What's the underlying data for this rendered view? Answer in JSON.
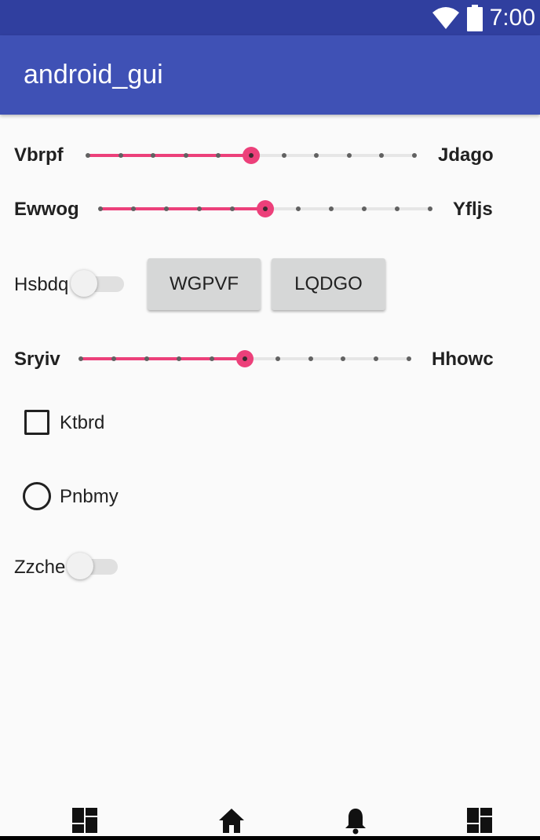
{
  "status": {
    "time": "7:00",
    "icons": [
      "wifi-icon",
      "battery-icon"
    ]
  },
  "app": {
    "title": "android_gui"
  },
  "sliders": [
    {
      "left_label": "Vbrpf",
      "right_label": "Jdago",
      "value": 5,
      "max": 10
    },
    {
      "left_label": "Ewwog",
      "right_label": "Yfljs",
      "value": 5,
      "max": 10
    },
    {
      "left_label": "Sryiv",
      "right_label": "Hhowc",
      "value": 5,
      "max": 10
    }
  ],
  "switches": [
    {
      "label": "Hsbdq",
      "checked": false
    },
    {
      "label": "Zzche",
      "checked": false
    }
  ],
  "buttons": {
    "first": "WGPVF",
    "second": "LQDGO"
  },
  "checkbox": {
    "label": "Ktbrd",
    "checked": false
  },
  "radio": {
    "label": "Pnbmy",
    "checked": false
  },
  "nav": {
    "icons": [
      "dashboard-icon",
      "home-icon",
      "bell-icon",
      "dashboard-icon"
    ]
  },
  "colors": {
    "status_bar": "#303f9f",
    "app_bar": "#3f51b5",
    "accent": "#ec407a"
  }
}
